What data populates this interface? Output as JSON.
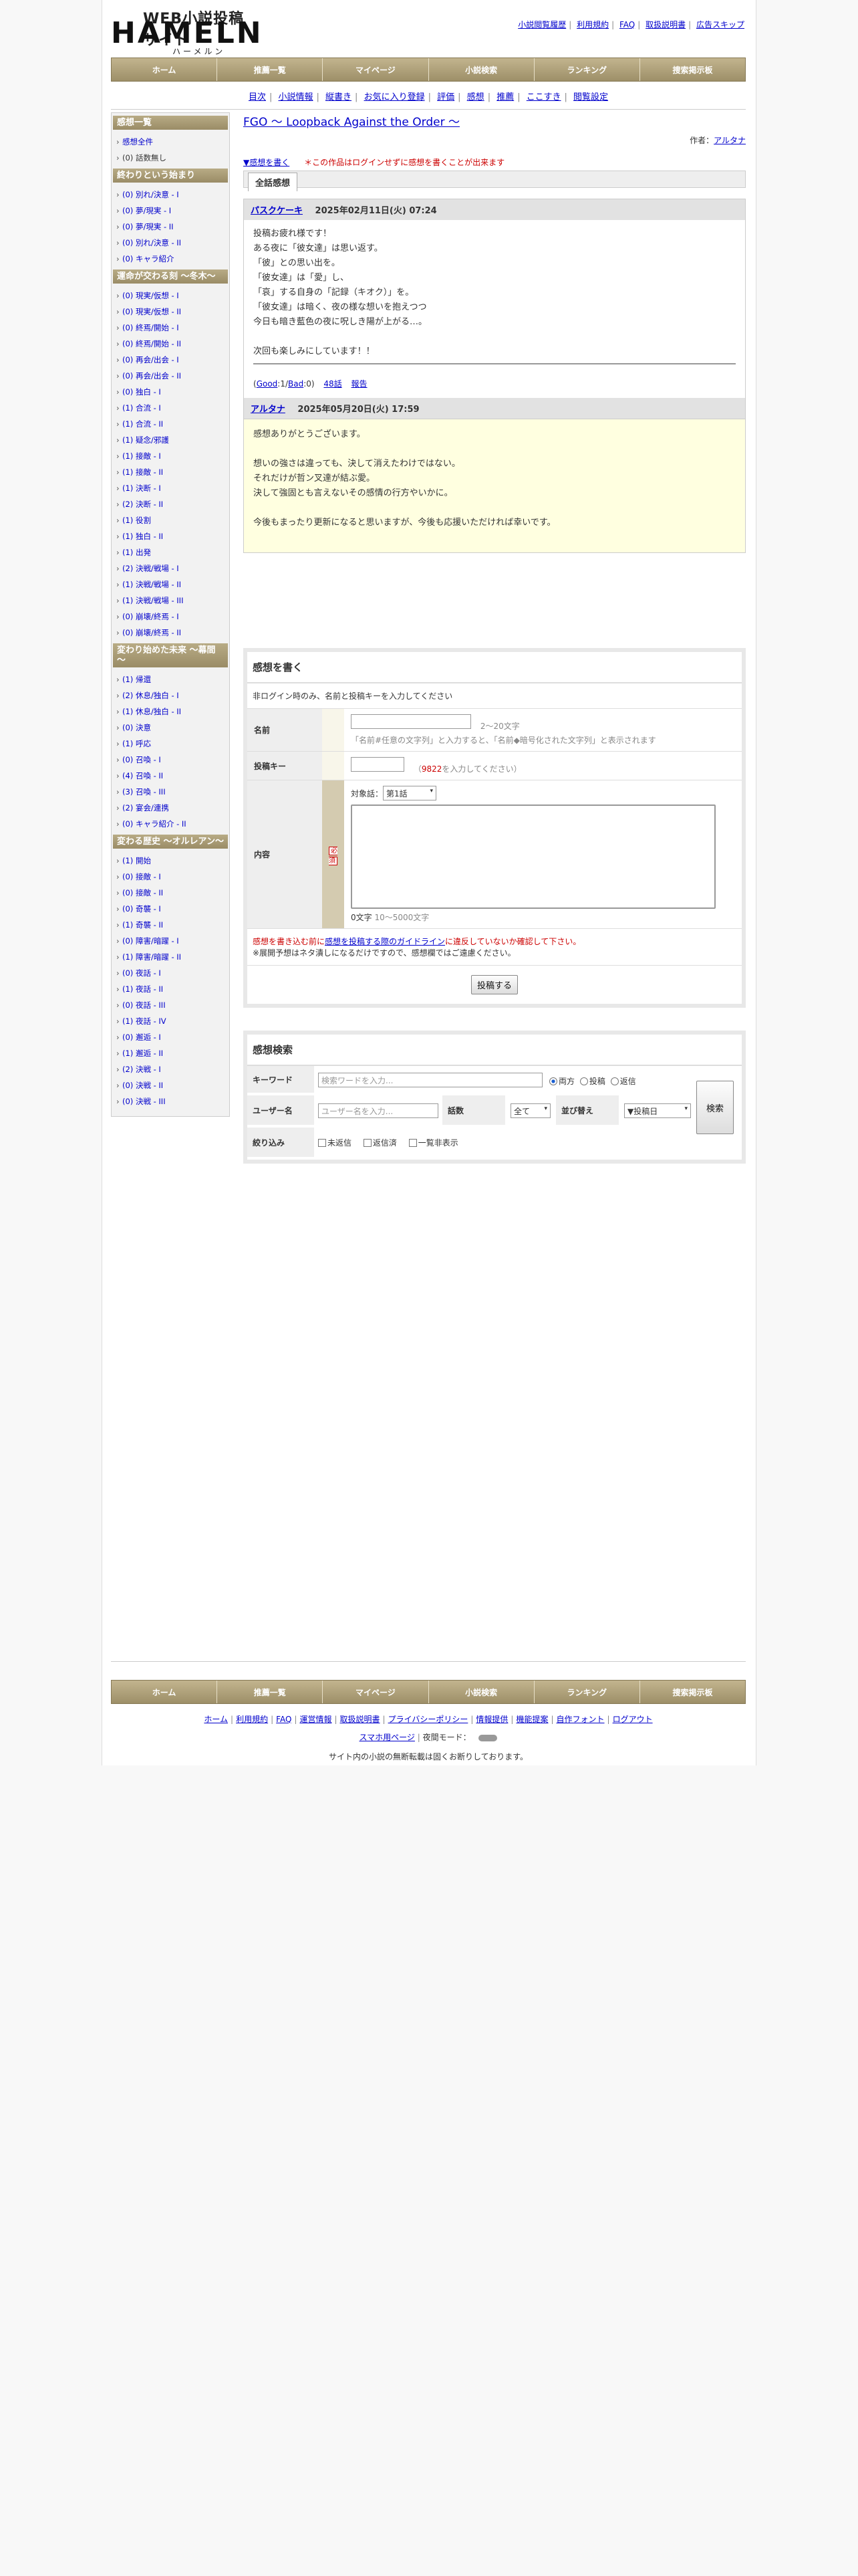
{
  "header": {
    "logo_tagline": "WEB小説投稿サイト",
    "logo_main": "HAMELN",
    "logo_kana": "ハーメルン",
    "top_links": [
      "小説閲覧履歴",
      "利用規約",
      "FAQ",
      "取扱説明書",
      "広告スキップ"
    ]
  },
  "nav": [
    "ホーム",
    "推薦一覧",
    "マイページ",
    "小説検索",
    "ランキング",
    "捜索掲示板"
  ],
  "subnav": [
    "目次",
    "小説情報",
    "縦書き",
    "お気に入り登録",
    "評価",
    "感想",
    "推薦",
    "ここすき",
    "閲覧設定"
  ],
  "sidebar": {
    "sections": [
      {
        "head": "感想一覧",
        "items": [
          {
            "label": "感想全件",
            "link": true
          },
          {
            "label": "(0) 話数無し",
            "link": false
          }
        ]
      },
      {
        "head": "終わりという始まり",
        "items": [
          "(0) 別れ/決意 - I",
          "(0) 夢/現実 - I",
          "(0) 夢/現実 - II",
          "(0) 別れ/決意 - II",
          "(0) キャラ紹介"
        ]
      },
      {
        "head": "運命が交わる刻 ～冬木～",
        "items": [
          "(0) 現実/仮想 - I",
          "(0) 現実/仮想 - II",
          "(0) 終焉/開始 - I",
          "(0) 終焉/開始 - II",
          "(0) 再会/出会 - I",
          "(0) 再会/出会 - II",
          "(0) 独白 - I",
          "(1) 合流 - I",
          "(1) 合流 - II",
          "(1) 疑念/邪護",
          "(1) 接敵 - I",
          "(1) 接敵 - II",
          "(1) 決断 - I",
          "(2) 決断 - II",
          "(1) 役割",
          "(1) 独白 - II",
          "(1) 出発",
          "(2) 決戦/戦場 - I",
          "(1) 決戦/戦場 - II",
          "(1) 決戦/戦場 - III",
          "(0) 崩壊/終焉 - I",
          "(0) 崩壊/終焉 - II"
        ]
      },
      {
        "head": "変わり始めた未来 ～幕間～",
        "items": [
          "(1) 帰還",
          "(2) 休息/独白 - I",
          "(1) 休息/独白 - II",
          "(0) 決意",
          "(1) 呼応",
          "(0) 召喚 - I",
          "(4) 召喚 - II",
          "(3) 召喚 - III",
          "(2) 宴会/連携",
          "(0) キャラ紹介 - II"
        ]
      },
      {
        "head": "変わる歴史 ～オルレアン～",
        "items": [
          "(1) 開始",
          "(0) 接敵 - I",
          "(0) 接敵 - II",
          "(0) 奇襲 - I",
          "(1) 奇襲 - II",
          "(0) 障害/暗躍 - I",
          "(1) 障害/暗躍 - II",
          "(0) 夜話 - I",
          "(1) 夜話 - II",
          "(0) 夜話 - III",
          "(1) 夜話 - IV",
          "(0) 邂逅 - I",
          "(1) 邂逅 - II",
          "(2) 決戦 - I",
          "(0) 決戦 - II",
          "(0) 決戦 - III"
        ]
      }
    ]
  },
  "main": {
    "title": "FGO ～ Loopback Against the Order ～",
    "author_label": "作者：",
    "author": "アルタナ",
    "write_link": "▼感想を書く",
    "login_notice": "＊この作品はログインせずに感想を書くことが出来ます",
    "tab": "全話感想",
    "review": {
      "user": "パスクケーキ",
      "date": "2025年02月11日(火) 07:24",
      "lines": [
        "投稿お疲れ様です！",
        "ある夜に「彼女達」は思い返す。",
        "「彼」との思い出を。",
        "「彼女達」は「愛」し、",
        "「哀」する自身の「記録（キオク）」を。",
        "「彼女達」は暗く、夜の様な想いを抱えつつ",
        "今日も暗き藍色の夜に呪しき陽が上がる…。",
        "",
        "次回も楽しみにしています！！"
      ],
      "meta_open": "(",
      "good": "Good",
      "good_count": ":1",
      "bad": "Bad",
      "bad_count": ":0)",
      "episode": "48話",
      "report": "報告"
    },
    "reply": {
      "user": "アルタナ",
      "date": "2025年05月20日(火) 17:59",
      "lines": [
        "感想ありがとうございます。",
        "",
        "想いの強さは違っても、決して消えたわけではない。",
        "それだけが哲ン叉達が結ぶ愛。",
        "決して強固とも言えないその感情の行方やいかに。",
        "",
        "今後もまったり更新になると思いますが、今後も応援いただければ幸いです。"
      ]
    }
  },
  "form": {
    "title": "感想を書く",
    "notice": "非ログイン時のみ、名前と投稿キーを入力してください",
    "name_label": "名前",
    "name_hint": "2～20文字",
    "name_hint2": "「名前#任意の文字列」と入力すると、「名前◆暗号化された文字列」と表示されます",
    "key_label": "投稿キー",
    "key_code": "9822",
    "key_hint": "を入力してください",
    "key_open": "（",
    "key_close": "）",
    "content_label": "内容",
    "required": "必須",
    "target_label": "対象話：",
    "target_value": "第1話",
    "char_count": "0文字",
    "char_range": "10～5000文字",
    "warn_pre": "感想を書き込む前に",
    "warn_link": "感想を投稿する際のガイドライン",
    "warn_post": "に違反していないか確認して下さい。",
    "note": "※展開予想はネタ潰しになるだけですので、感想欄ではご遠慮ください。",
    "submit": "投稿する"
  },
  "search": {
    "title": "感想検索",
    "keyword_label": "キーワード",
    "keyword_placeholder": "検索ワードを入力...",
    "radio_both": "両方",
    "radio_post": "投稿",
    "radio_reply": "返信",
    "user_label": "ユーザー名",
    "user_placeholder": "ユーザー名を入力...",
    "episode_label": "話数",
    "episode_value": "全て",
    "sort_label": "並び替え",
    "sort_value": "▼投稿日",
    "search_button": "検索",
    "filter_label": "絞り込み",
    "filter_unreplied": "未返信",
    "filter_replied": "返信済",
    "filter_hidden": "一覧非表示"
  },
  "footer": {
    "links": [
      "ホーム",
      "利用規約",
      "FAQ",
      "運営情報",
      "取扱説明書",
      "プライバシーポリシー",
      "情報提供",
      "機能提案",
      "自作フォント",
      "ログアウト"
    ],
    "mobile": "スマホ用ページ",
    "theme_label": "夜間モード：",
    "copyright": "サイト内の小説の無断転載は固くお断りしております。"
  }
}
